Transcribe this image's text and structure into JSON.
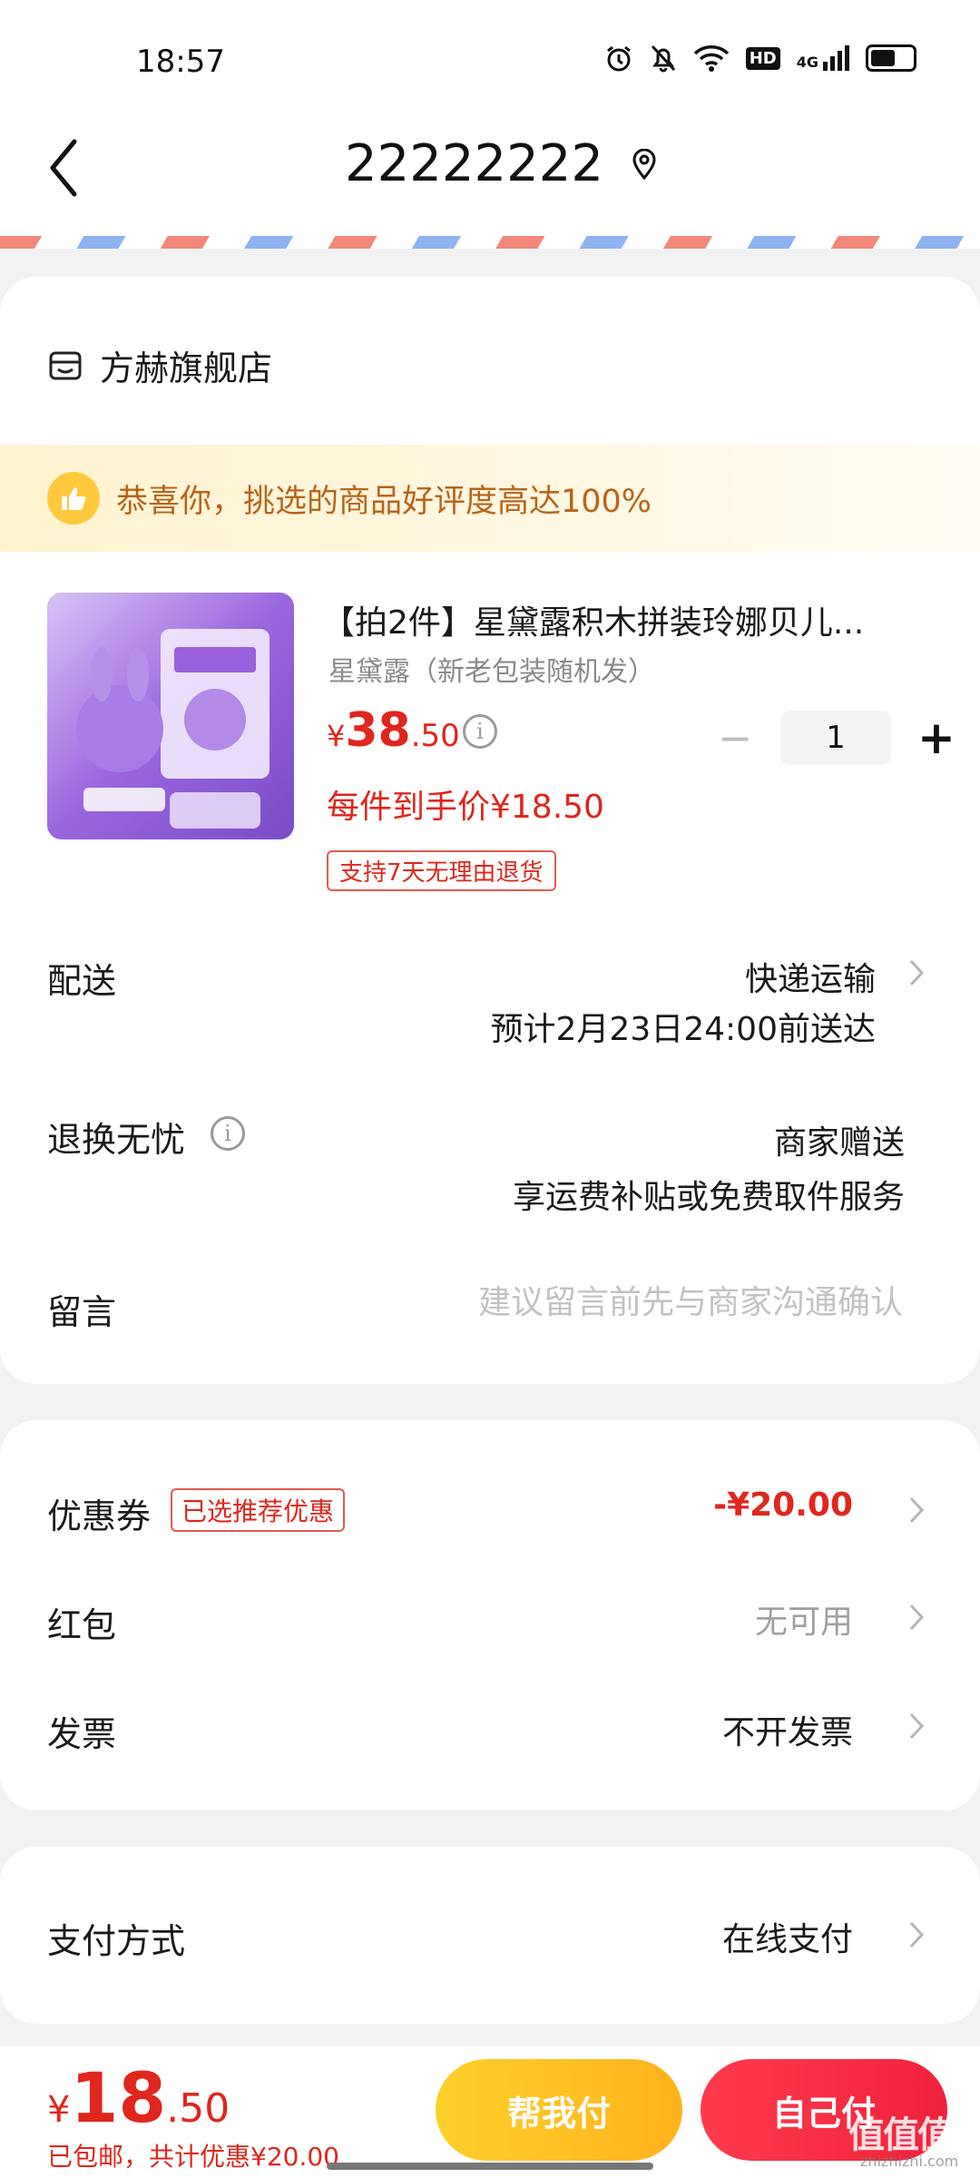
{
  "status_bar": {
    "time": "18:57",
    "icons": [
      "alarm-icon",
      "bell-off-icon",
      "wifi-icon",
      "hd-icon",
      "signal-4g-icon",
      "battery-icon"
    ],
    "hd_label": "HD",
    "network_label": "4G"
  },
  "nav": {
    "title": "22222222",
    "back_icon": "chevron-left-icon",
    "location_icon": "location-pin-icon"
  },
  "store": {
    "icon": "store-icon",
    "name": "方赫旗舰店"
  },
  "praise_banner": {
    "icon": "thumbs-up-icon",
    "text": "恭喜你，挑选的商品好评度高达100%"
  },
  "product": {
    "title": "【拍2件】星黛露积木拼装玲娜贝儿...",
    "variant": "星黛露（新老包装随机发）",
    "price_symbol": "¥",
    "price_integer": "38",
    "price_decimal": ".50",
    "quantity": "1",
    "unit_price_text": "每件到手价¥18.50",
    "return_tag": "支持7天无理由退货"
  },
  "delivery": {
    "label": "配送",
    "method": "快递运输",
    "eta": "预计2月23日24:00前送达"
  },
  "returns": {
    "label": "退换无忧",
    "line1": "商家赠送",
    "line2": "享运费补贴或免费取件服务"
  },
  "message": {
    "label": "留言",
    "placeholder": "建议留言前先与商家沟通确认"
  },
  "coupon": {
    "label": "优惠券",
    "badge": "已选推荐优惠",
    "value": "-¥20.00"
  },
  "red_packet": {
    "label": "红包",
    "value": "无可用"
  },
  "invoice": {
    "label": "发票",
    "value": "不开发票"
  },
  "payment": {
    "label": "支付方式",
    "value": "在线支付"
  },
  "footer": {
    "total_symbol": "¥",
    "total_integer": "18",
    "total_decimal": ".50",
    "note": "已包邮，共计优惠¥20.00",
    "help_pay_label": "帮我付",
    "self_pay_label": "自己付"
  },
  "watermark": {
    "text": "值值值",
    "sub": "zhizhizhi.com"
  },
  "colors": {
    "accent_red": "#e0261d",
    "help_button": "#ffc21f",
    "self_button": "#f52c44",
    "praise_text": "#b8651a"
  }
}
